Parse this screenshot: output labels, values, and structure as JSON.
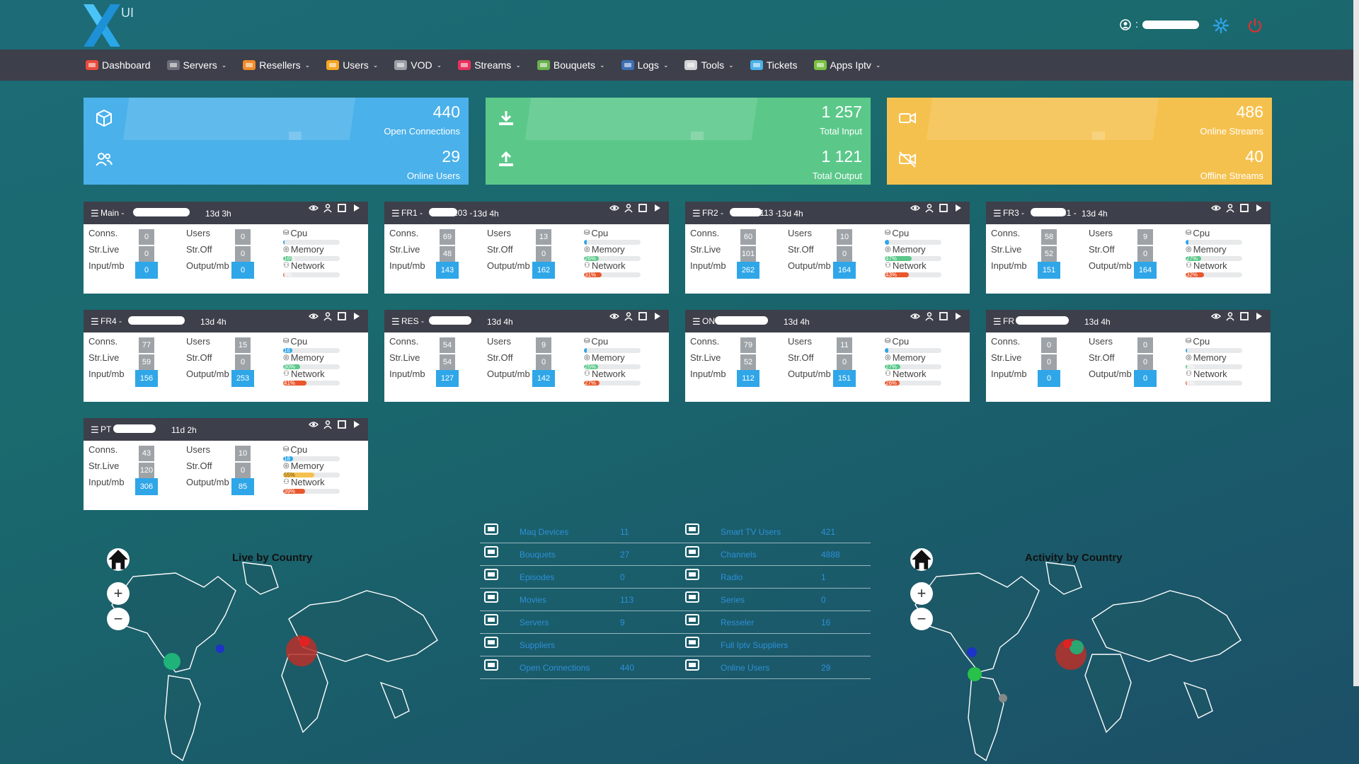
{
  "brand": {
    "logo_letter": "X",
    "logo_suffix": "UI"
  },
  "header": {
    "user_prefix": ":"
  },
  "nav": [
    {
      "label": "Dashboard",
      "icon": "dashboard-icon",
      "caret": false
    },
    {
      "label": "Servers",
      "icon": "servers-icon",
      "caret": true
    },
    {
      "label": "Resellers",
      "icon": "resellers-icon",
      "caret": true
    },
    {
      "label": "Users",
      "icon": "users-icon",
      "caret": true
    },
    {
      "label": "VOD",
      "icon": "vod-icon",
      "caret": true
    },
    {
      "label": "Streams",
      "icon": "streams-icon",
      "caret": true
    },
    {
      "label": "Bouquets",
      "icon": "bouquets-icon",
      "caret": true
    },
    {
      "label": "Logs",
      "icon": "logs-icon",
      "caret": true
    },
    {
      "label": "Tools",
      "icon": "tools-icon",
      "caret": true
    },
    {
      "label": "Tickets",
      "icon": "tickets-icon",
      "caret": false
    },
    {
      "label": "Apps Iptv",
      "icon": "apps-icon",
      "caret": true
    }
  ],
  "summary": [
    {
      "color": "#4ab1ea",
      "top_value": "440",
      "top_label": "Open Connections",
      "bottom_value": "29",
      "bottom_label": "Online Users",
      "top_icon": "cube-icon",
      "bottom_icon": "users-icon"
    },
    {
      "color": "#5bc88a",
      "top_value": "1 257",
      "top_label": "Total Input",
      "bottom_value": "1 121",
      "bottom_label": "Total Output",
      "top_icon": "download-icon",
      "bottom_icon": "upload-icon"
    },
    {
      "color": "#f5c14e",
      "top_value": "486",
      "top_label": "Online Streams",
      "bottom_value": "40",
      "bottom_label": "Offline Streams",
      "top_icon": "video-icon",
      "bottom_icon": "video-off-icon"
    }
  ],
  "labels": {
    "conns": "Conns.",
    "users": "Users",
    "str_live": "Str.Live",
    "str_off": "Str.Off",
    "input": "Input/mb",
    "output": "Output/mb",
    "cpu": "Cpu",
    "memory": "Memory",
    "network": "Network"
  },
  "servers": [
    {
      "name": "Main -",
      "suffix": "-",
      "uptime": "13d 3h",
      "conns": "0",
      "users": "0",
      "live": "0",
      "off": "0",
      "input": "0",
      "output": "0",
      "cpu": 1,
      "cpu_label": "",
      "mem": 16,
      "mem_label": "16%",
      "net": 0,
      "net_label": "0%"
    },
    {
      "name": "FR1 -",
      "suffix": "203 -",
      "uptime": "13d 4h",
      "conns": "69",
      "users": "13",
      "live": "48",
      "off": "0",
      "input": "143",
      "output": "162",
      "cpu": 5,
      "cpu_label": "",
      "mem": 26,
      "mem_label": "26%",
      "net": 31,
      "net_label": "31%"
    },
    {
      "name": "FR2 -",
      "suffix": ".113 -",
      "uptime": "13d 4h",
      "conns": "60",
      "users": "10",
      "live": "101",
      "off": "0",
      "input": "262",
      "output": "164",
      "cpu": 7,
      "cpu_label": "",
      "mem": 47,
      "mem_label": "47%",
      "net": 43,
      "net_label": "43%"
    },
    {
      "name": "FR3 -",
      "suffix": "41 -",
      "uptime": "13d 4h",
      "conns": "58",
      "users": "9",
      "live": "52",
      "off": "0",
      "input": "151",
      "output": "164",
      "cpu": 5,
      "cpu_label": "",
      "mem": 27,
      "mem_label": "27%",
      "net": 32,
      "net_label": "32%"
    },
    {
      "name": "FR4 -",
      "suffix": "",
      "uptime": "13d 4h",
      "conns": "77",
      "users": "15",
      "live": "59",
      "off": "0",
      "input": "156",
      "output": "253",
      "cpu": 16,
      "cpu_label": "16",
      "mem": 30,
      "mem_label": "30%",
      "net": 41,
      "net_label": "41%"
    },
    {
      "name": "RES -",
      "suffix": "",
      "uptime": "13d 4h",
      "conns": "54",
      "users": "9",
      "live": "54",
      "off": "0",
      "input": "127",
      "output": "142",
      "cpu": 5,
      "cpu_label": "",
      "mem": 25,
      "mem_label": "25%",
      "net": 27,
      "net_label": "27%"
    },
    {
      "name": "ON",
      "suffix": "-",
      "uptime": "13d 4h",
      "conns": "79",
      "users": "11",
      "live": "52",
      "off": "0",
      "input": "112",
      "output": "151",
      "cpu": 6,
      "cpu_label": "",
      "mem": 27,
      "mem_label": "27%",
      "net": 26,
      "net_label": "26%"
    },
    {
      "name": "FR",
      "suffix": "",
      "uptime": "13d 4h",
      "conns": "0",
      "users": "0",
      "live": "0",
      "off": "0",
      "input": "0",
      "output": "0",
      "cpu": 1,
      "cpu_label": "",
      "mem": 3,
      "mem_label": "3%",
      "net": 0,
      "net_label": "0%"
    },
    {
      "name": "PT",
      "suffix": "-",
      "uptime": "11d 2h",
      "conns": "43",
      "users": "10",
      "live": "120",
      "off": "0",
      "input": "306",
      "output": "85",
      "cpu": 18,
      "cpu_label": "18",
      "mem": 55,
      "mem_label": "55%",
      "net": 39,
      "net_label": "39%"
    }
  ],
  "stats": [
    [
      {
        "label": "Maq Devices",
        "value": "11",
        "icon": "monitor-icon"
      },
      {
        "label": "Smart TV Users",
        "value": "421",
        "icon": "smart-tv-icon"
      }
    ],
    [
      {
        "label": "Bouquets",
        "value": "27",
        "icon": "layers-icon"
      },
      {
        "label": "Channels",
        "value": "4888",
        "icon": "list-icon"
      }
    ],
    [
      {
        "label": "Episodes",
        "value": "0",
        "icon": "file-icon"
      },
      {
        "label": "Radio",
        "value": "1",
        "icon": "music-icon"
      }
    ],
    [
      {
        "label": "Movies",
        "value": "113",
        "icon": "camera-icon"
      },
      {
        "label": "Series",
        "value": "0",
        "icon": "film-icon"
      }
    ],
    [
      {
        "label": "Servers",
        "value": "9",
        "icon": "server-icon"
      },
      {
        "label": "Resseler",
        "value": "16",
        "icon": "group-icon"
      }
    ],
    [
      {
        "label": "Suppliers",
        "value": "",
        "icon": "supplier-icon"
      },
      {
        "label": "Full Iptv Suppliers",
        "value": "",
        "icon": "user-gear-icon"
      }
    ],
    [
      {
        "label": "Open Connections",
        "value": "440",
        "icon": "bolt-icon"
      },
      {
        "label": "Online Users",
        "value": "29",
        "icon": "users-icon"
      }
    ]
  ],
  "maps": [
    {
      "title": "Live by Country"
    },
    {
      "title": "Activity by Country"
    }
  ],
  "colors": {
    "navbar": "#3d3f4a",
    "link": "#2e8fd8",
    "net": "#e8572d",
    "mem": "#5bc88a",
    "cpu": "#2fa6e8",
    "mem_warn": "#f5c14e"
  }
}
